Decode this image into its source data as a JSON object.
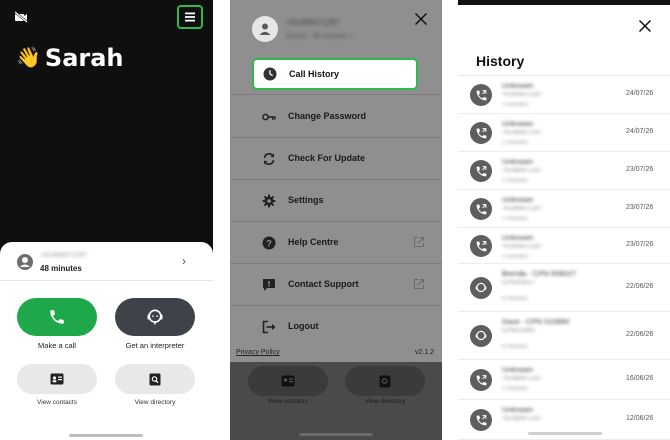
{
  "home": {
    "greeting_emoji": "👋",
    "user_name": "Sarah",
    "account_number": "+61489471297",
    "minutes": "48 minutes",
    "make_call": "Make a call",
    "get_interpreter": "Get an interpreter",
    "view_contacts": "View contacts",
    "view_directory": "View directory",
    "accent": "#2fb84f",
    "make_call_color": "#1fa84a",
    "interpreter_color": "#3f4349"
  },
  "drawer": {
    "account_number": "+61489471297",
    "account_sub": "Reach - 48 minutes >",
    "items": [
      {
        "label": "Call History",
        "icon": "clock-icon"
      },
      {
        "label": "Change Password",
        "icon": "key-icon"
      },
      {
        "label": "Check For Update",
        "icon": "refresh-icon"
      },
      {
        "label": "Settings",
        "icon": "gear-icon"
      },
      {
        "label": "Help Centre",
        "icon": "question-icon"
      },
      {
        "label": "Contact Support",
        "icon": "support-icon"
      },
      {
        "label": "Logout",
        "icon": "logout-icon"
      }
    ],
    "privacy_policy": "Privacy Policy",
    "version": "v2.1.2",
    "bg_view_contacts": "View contacts",
    "bg_view_directory": "View directory"
  },
  "history": {
    "title": "History",
    "rows": [
      {
        "name": "Unknown",
        "sub": "+61489471297",
        "sub2": "2 minutes",
        "date": "24/07/26",
        "type": "phone"
      },
      {
        "name": "Unknown",
        "sub": "+61489471297",
        "sub2": "2 minutes",
        "date": "24/07/26",
        "type": "phone"
      },
      {
        "name": "Unknown",
        "sub": "+61489471297",
        "sub2": "2 minutes",
        "date": "23/07/26",
        "type": "phone"
      },
      {
        "name": "Unknown",
        "sub": "+61489471297",
        "sub2": "2 minutes",
        "date": "23/07/26",
        "type": "phone"
      },
      {
        "name": "Unknown",
        "sub": "+61489471297",
        "sub2": "2 minutes",
        "date": "23/07/26",
        "type": "phone"
      },
      {
        "name": "Brenda - CPN 009027",
        "sub": "CPN009027",
        "sub2": "8 minutes",
        "date": "22/06/26",
        "type": "interpreter"
      },
      {
        "name": "Dave - CPN 010990",
        "sub": "CPN010990",
        "sub2": "8 minutes",
        "date": "22/06/26",
        "type": "interpreter"
      },
      {
        "name": "Unknown",
        "sub": "+61489471297",
        "sub2": "2 minutes",
        "date": "16/06/26",
        "type": "phone"
      },
      {
        "name": "Unknown",
        "sub": "+61489471297",
        "sub2": "",
        "date": "12/06/26",
        "type": "phone"
      }
    ]
  }
}
